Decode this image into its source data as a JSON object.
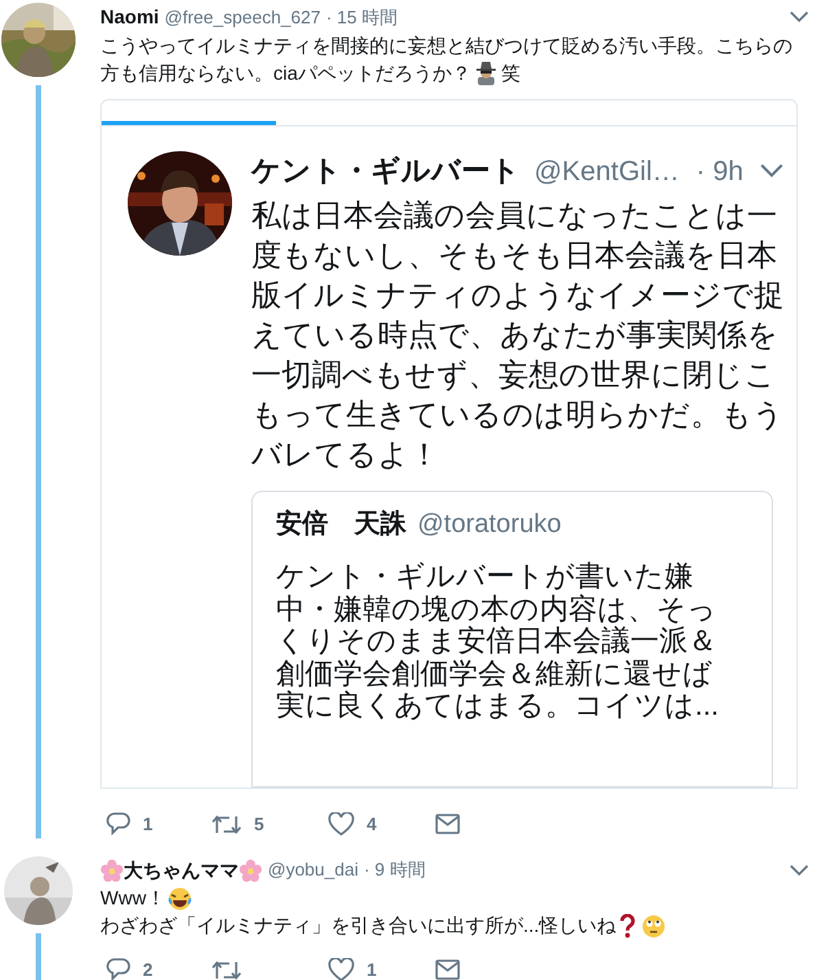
{
  "tweets": [
    {
      "name_parts": [
        {
          "kind": "text",
          "text": "Naomi"
        }
      ],
      "handle": "@free_speech_627",
      "time": "· 15 時間",
      "text_lines": [
        [
          {
            "kind": "text",
            "text": "こうやってイルミナティを間接的に妄想と結びつけて貶める汚い手段。こちらの"
          }
        ],
        [
          {
            "kind": "text",
            "text": "方も信用ならない。ciaパペットだろうか？"
          },
          {
            "kind": "spy"
          },
          {
            "kind": "text",
            "text": "笑"
          }
        ]
      ],
      "embedded": {
        "name": "ケント・ギルバート",
        "handle": "@KentGil…",
        "time": "· 9h",
        "text_lines": [
          "私は日本会議の会員になったことは一",
          "度もないし、そもそも日本会議を日本",
          "版イルミナティのようなイメージで捉",
          "えている時点で、あなたが事実関係を",
          "一切調べもせず、妄想の世界に閉じこ",
          "もって生きているのは明らかだ。もう",
          "バレてるよ！"
        ],
        "quote": {
          "name": "安倍　天誅",
          "handle": "@toratoruko",
          "text_lines": [
            "ケント・ギルバートが書いた嫌",
            "中・嫌韓の塊の本の内容は、そっ",
            "くりそのまま安倍日本会議一派＆",
            "創価学会創価学会＆維新に還せば",
            "実に良くあてはまる。コイツは..."
          ]
        }
      },
      "actions": [
        {
          "kind": "reply",
          "count": "1"
        },
        {
          "kind": "retweet",
          "count": "5"
        },
        {
          "kind": "like",
          "count": "4"
        },
        {
          "kind": "mail"
        }
      ]
    },
    {
      "name_parts": [
        {
          "kind": "flower"
        },
        {
          "kind": "text",
          "text": "大ちゃんママ"
        },
        {
          "kind": "flower"
        }
      ],
      "handle": "@yobu_dai",
      "time": "· 9 時間",
      "text_lines": [
        [
          {
            "kind": "text",
            "text": "Www！"
          },
          {
            "kind": "laugh"
          }
        ],
        [
          {
            "kind": "text",
            "text": "わざわざ「イルミナティ」を引き合いに出す所が...怪しいね"
          },
          {
            "kind": "question"
          },
          {
            "kind": "eyeroll"
          }
        ]
      ],
      "actions": [
        {
          "kind": "reply",
          "count": "2"
        },
        {
          "kind": "retweet"
        },
        {
          "kind": "like",
          "count": "1"
        },
        {
          "kind": "mail"
        }
      ]
    }
  ]
}
